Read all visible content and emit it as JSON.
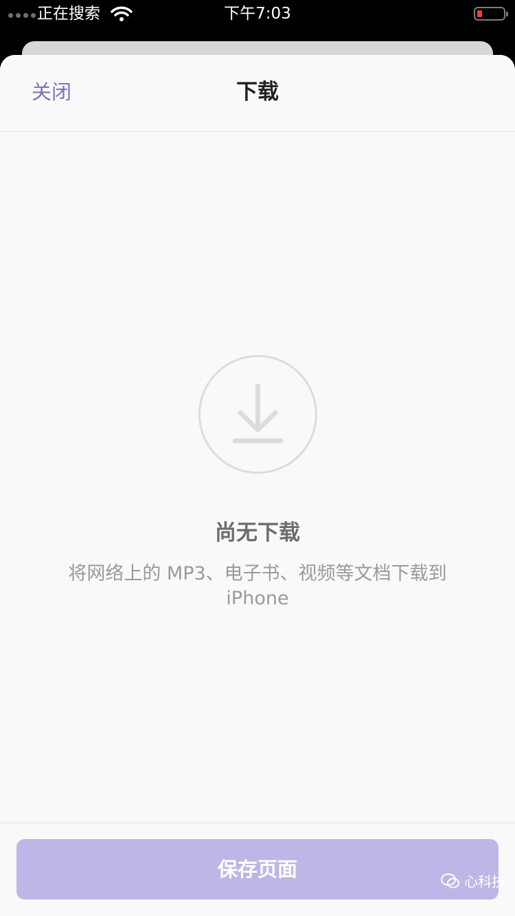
{
  "status_bar": {
    "carrier": "正在搜索",
    "time": "下午7:03",
    "icons": [
      "signal-dots-icon",
      "wifi-icon",
      "battery-low-icon"
    ],
    "battery_color": "#ff3b30"
  },
  "nav": {
    "close_label": "关闭",
    "title": "下载",
    "accent_color": "#7f73b7"
  },
  "empty_state": {
    "icon": "download-icon",
    "title": "尚无下载",
    "description_line1": "将网络上的 MP3、电子书、视频等文档下载到",
    "description_line2": "iPhone"
  },
  "footer": {
    "save_label": "保存页面",
    "button_color": "#bdb6e6"
  },
  "watermark": {
    "icon": "wechat-icon",
    "text": "心科技"
  }
}
